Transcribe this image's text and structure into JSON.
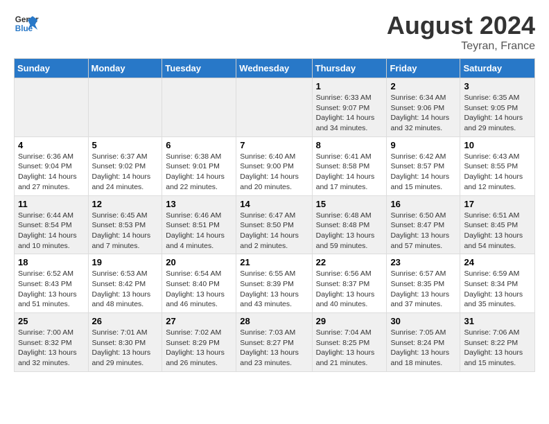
{
  "header": {
    "logo_line1": "General",
    "logo_line2": "Blue",
    "month_title": "August 2024",
    "location": "Teyran, France"
  },
  "weekdays": [
    "Sunday",
    "Monday",
    "Tuesday",
    "Wednesday",
    "Thursday",
    "Friday",
    "Saturday"
  ],
  "weeks": [
    [
      {
        "day": "",
        "info": ""
      },
      {
        "day": "",
        "info": ""
      },
      {
        "day": "",
        "info": ""
      },
      {
        "day": "",
        "info": ""
      },
      {
        "day": "1",
        "info": "Sunrise: 6:33 AM\nSunset: 9:07 PM\nDaylight: 14 hours\nand 34 minutes."
      },
      {
        "day": "2",
        "info": "Sunrise: 6:34 AM\nSunset: 9:06 PM\nDaylight: 14 hours\nand 32 minutes."
      },
      {
        "day": "3",
        "info": "Sunrise: 6:35 AM\nSunset: 9:05 PM\nDaylight: 14 hours\nand 29 minutes."
      }
    ],
    [
      {
        "day": "4",
        "info": "Sunrise: 6:36 AM\nSunset: 9:04 PM\nDaylight: 14 hours\nand 27 minutes."
      },
      {
        "day": "5",
        "info": "Sunrise: 6:37 AM\nSunset: 9:02 PM\nDaylight: 14 hours\nand 24 minutes."
      },
      {
        "day": "6",
        "info": "Sunrise: 6:38 AM\nSunset: 9:01 PM\nDaylight: 14 hours\nand 22 minutes."
      },
      {
        "day": "7",
        "info": "Sunrise: 6:40 AM\nSunset: 9:00 PM\nDaylight: 14 hours\nand 20 minutes."
      },
      {
        "day": "8",
        "info": "Sunrise: 6:41 AM\nSunset: 8:58 PM\nDaylight: 14 hours\nand 17 minutes."
      },
      {
        "day": "9",
        "info": "Sunrise: 6:42 AM\nSunset: 8:57 PM\nDaylight: 14 hours\nand 15 minutes."
      },
      {
        "day": "10",
        "info": "Sunrise: 6:43 AM\nSunset: 8:55 PM\nDaylight: 14 hours\nand 12 minutes."
      }
    ],
    [
      {
        "day": "11",
        "info": "Sunrise: 6:44 AM\nSunset: 8:54 PM\nDaylight: 14 hours\nand 10 minutes."
      },
      {
        "day": "12",
        "info": "Sunrise: 6:45 AM\nSunset: 8:53 PM\nDaylight: 14 hours\nand 7 minutes."
      },
      {
        "day": "13",
        "info": "Sunrise: 6:46 AM\nSunset: 8:51 PM\nDaylight: 14 hours\nand 4 minutes."
      },
      {
        "day": "14",
        "info": "Sunrise: 6:47 AM\nSunset: 8:50 PM\nDaylight: 14 hours\nand 2 minutes."
      },
      {
        "day": "15",
        "info": "Sunrise: 6:48 AM\nSunset: 8:48 PM\nDaylight: 13 hours\nand 59 minutes."
      },
      {
        "day": "16",
        "info": "Sunrise: 6:50 AM\nSunset: 8:47 PM\nDaylight: 13 hours\nand 57 minutes."
      },
      {
        "day": "17",
        "info": "Sunrise: 6:51 AM\nSunset: 8:45 PM\nDaylight: 13 hours\nand 54 minutes."
      }
    ],
    [
      {
        "day": "18",
        "info": "Sunrise: 6:52 AM\nSunset: 8:43 PM\nDaylight: 13 hours\nand 51 minutes."
      },
      {
        "day": "19",
        "info": "Sunrise: 6:53 AM\nSunset: 8:42 PM\nDaylight: 13 hours\nand 48 minutes."
      },
      {
        "day": "20",
        "info": "Sunrise: 6:54 AM\nSunset: 8:40 PM\nDaylight: 13 hours\nand 46 minutes."
      },
      {
        "day": "21",
        "info": "Sunrise: 6:55 AM\nSunset: 8:39 PM\nDaylight: 13 hours\nand 43 minutes."
      },
      {
        "day": "22",
        "info": "Sunrise: 6:56 AM\nSunset: 8:37 PM\nDaylight: 13 hours\nand 40 minutes."
      },
      {
        "day": "23",
        "info": "Sunrise: 6:57 AM\nSunset: 8:35 PM\nDaylight: 13 hours\nand 37 minutes."
      },
      {
        "day": "24",
        "info": "Sunrise: 6:59 AM\nSunset: 8:34 PM\nDaylight: 13 hours\nand 35 minutes."
      }
    ],
    [
      {
        "day": "25",
        "info": "Sunrise: 7:00 AM\nSunset: 8:32 PM\nDaylight: 13 hours\nand 32 minutes."
      },
      {
        "day": "26",
        "info": "Sunrise: 7:01 AM\nSunset: 8:30 PM\nDaylight: 13 hours\nand 29 minutes."
      },
      {
        "day": "27",
        "info": "Sunrise: 7:02 AM\nSunset: 8:29 PM\nDaylight: 13 hours\nand 26 minutes."
      },
      {
        "day": "28",
        "info": "Sunrise: 7:03 AM\nSunset: 8:27 PM\nDaylight: 13 hours\nand 23 minutes."
      },
      {
        "day": "29",
        "info": "Sunrise: 7:04 AM\nSunset: 8:25 PM\nDaylight: 13 hours\nand 21 minutes."
      },
      {
        "day": "30",
        "info": "Sunrise: 7:05 AM\nSunset: 8:24 PM\nDaylight: 13 hours\nand 18 minutes."
      },
      {
        "day": "31",
        "info": "Sunrise: 7:06 AM\nSunset: 8:22 PM\nDaylight: 13 hours\nand 15 minutes."
      }
    ]
  ]
}
